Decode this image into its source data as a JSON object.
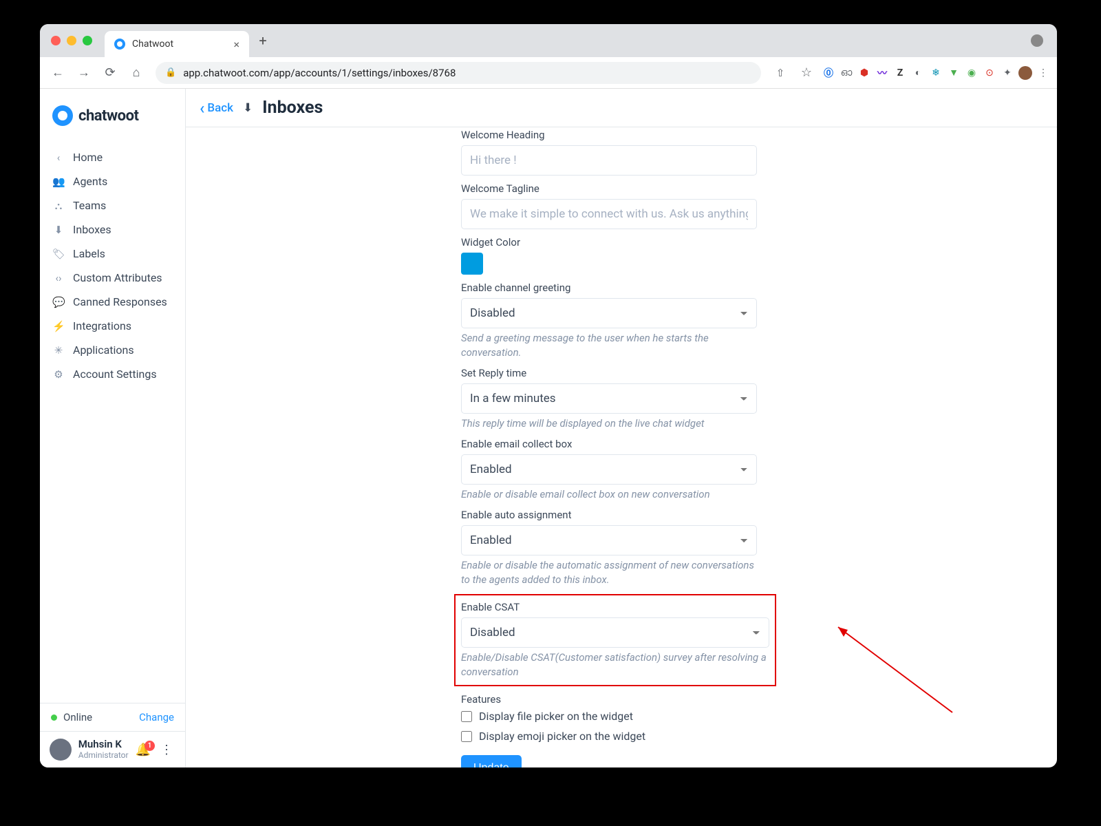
{
  "browser": {
    "tab_title": "Chatwoot",
    "address": "app.chatwoot.com/app/accounts/1/settings/inboxes/8768"
  },
  "sidebar": {
    "logo_text": "chatwoot",
    "items": [
      {
        "icon": "‹",
        "label": "Home"
      },
      {
        "icon": "👥",
        "label": "Agents"
      },
      {
        "icon": "⛬",
        "label": "Teams"
      },
      {
        "icon": "⬇",
        "label": "Inboxes"
      },
      {
        "icon": "🏷",
        "label": "Labels"
      },
      {
        "icon": "‹›",
        "label": "Custom Attributes"
      },
      {
        "icon": "💬",
        "label": "Canned Responses"
      },
      {
        "icon": "⚡",
        "label": "Integrations"
      },
      {
        "icon": "✳",
        "label": "Applications"
      },
      {
        "icon": "⚙",
        "label": "Account Settings"
      }
    ],
    "status": "Online",
    "change": "Change",
    "user_name": "Muhsin K",
    "user_role": "Administrator",
    "badge": "1"
  },
  "header": {
    "back": "Back",
    "title": "Inboxes"
  },
  "form": {
    "welcome_heading_label": "Welcome Heading",
    "welcome_heading_ph": "Hi there !",
    "welcome_tagline_label": "Welcome Tagline",
    "welcome_tagline_ph": "We make it simple to connect with us. Ask us anything, or share feedback.",
    "widget_color_label": "Widget Color",
    "channel_greeting_label": "Enable channel greeting",
    "channel_greeting_value": "Disabled",
    "channel_greeting_hint": "Send a greeting message to the user when he starts the conversation.",
    "reply_time_label": "Set Reply time",
    "reply_time_value": "In a few minutes",
    "reply_time_hint": "This reply time will be displayed on the live chat widget",
    "email_collect_label": "Enable email collect box",
    "email_collect_value": "Enabled",
    "email_collect_hint": "Enable or disable email collect box on new conversation",
    "auto_assign_label": "Enable auto assignment",
    "auto_assign_value": "Enabled",
    "auto_assign_hint": "Enable or disable the automatic assignment of new conversations to the agents added to this inbox.",
    "csat_label": "Enable CSAT",
    "csat_value": "Disabled",
    "csat_hint": "Enable/Disable CSAT(Customer satisfaction) survey after resolving a conversation",
    "features_label": "Features",
    "feature_file": "Display file picker on the widget",
    "feature_emoji": "Display emoji picker on the widget",
    "update_btn": "Update"
  }
}
